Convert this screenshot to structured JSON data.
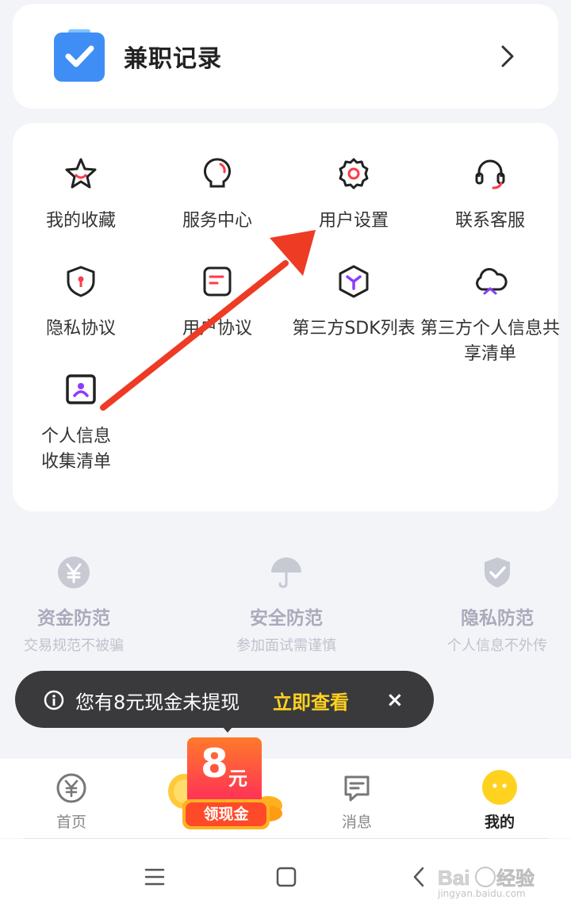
{
  "record": {
    "title": "兼职记录",
    "icon": "checkbox-icon"
  },
  "menu": {
    "items": [
      {
        "label": "我的收藏",
        "icon": "star-icon"
      },
      {
        "label": "服务中心",
        "icon": "bulb-icon"
      },
      {
        "label": "用户设置",
        "icon": "gear-icon"
      },
      {
        "label": "联系客服",
        "icon": "headset-icon"
      },
      {
        "label": "隐私协议",
        "icon": "shield-lock-icon"
      },
      {
        "label": "用户协议",
        "icon": "document-icon"
      },
      {
        "label": "第三方SDK列表",
        "icon": "hexagon-icon"
      },
      {
        "label": "第三方个人信息共享清单",
        "icon": "cloud-icon"
      },
      {
        "label": "个人信息收集清单",
        "icon": "profile-card-icon"
      }
    ]
  },
  "safety": [
    {
      "title": "资金防范",
      "subtitle": "交易规范不被骗",
      "icon": "yuan-coin-icon"
    },
    {
      "title": "安全防范",
      "subtitle": "参加面试需谨慎",
      "icon": "umbrella-icon"
    },
    {
      "title": "隐私防范",
      "subtitle": "个人信息不外传",
      "icon": "shield-check-icon"
    }
  ],
  "toast": {
    "message": "您有8元现金未提现",
    "action": "立即查看",
    "close": "×"
  },
  "tabs": [
    {
      "label": "首页",
      "icon": "yuan-circle-icon"
    },
    {
      "label": "消息",
      "icon": "message-icon"
    },
    {
      "label": "我的",
      "icon": "face-icon"
    }
  ],
  "cash_promo": {
    "amount": "8",
    "unit": "元",
    "button": "领现金"
  },
  "colors": {
    "accent_yellow": "#ffd21f",
    "promo_red": "#ff4a2a",
    "arrow_red": "#ee3b24"
  },
  "watermark": {
    "brand": "Baidu经验",
    "url": "jingyan.baidu.com"
  }
}
